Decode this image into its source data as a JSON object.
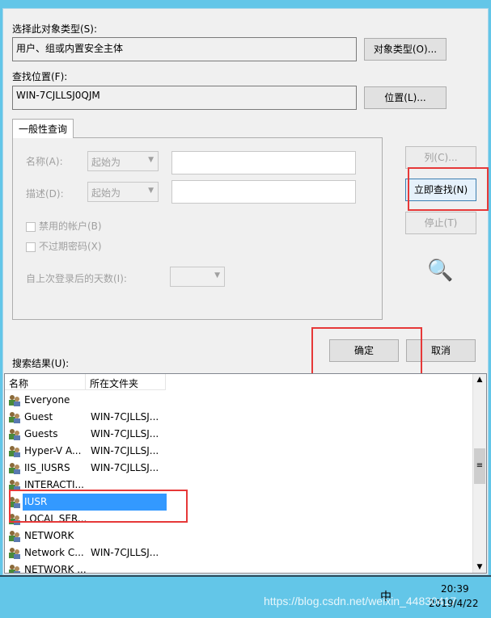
{
  "object_type": {
    "label": "选择此对象类型(S):",
    "value": "用户、组或内置安全主体",
    "button": "对象类型(O)..."
  },
  "location": {
    "label": "查找位置(F):",
    "value": "WIN-7CJLLSJ0QJM",
    "button": "位置(L)..."
  },
  "query_tab": {
    "label": "一般性查询",
    "name_label": "名称(A):",
    "name_mode": "起始为",
    "desc_label": "描述(D):",
    "desc_mode": "起始为",
    "disabled_accounts": "禁用的帐户(B)",
    "no_expire_pwd": "不过期密码(X)",
    "days_label": "自上次登录后的天数(I):"
  },
  "side_buttons": {
    "columns": "列(C)...",
    "find_now": "立即查找(N)",
    "stop": "停止(T)"
  },
  "ok": "确定",
  "cancel": "取消",
  "results": {
    "label": "搜索结果(U):",
    "columns": [
      "名称",
      "所在文件夹"
    ],
    "rows": [
      {
        "name": "Everyone",
        "folder": ""
      },
      {
        "name": "Guest",
        "folder": "WIN-7CJLLSJ..."
      },
      {
        "name": "Guests",
        "folder": "WIN-7CJLLSJ..."
      },
      {
        "name": "Hyper-V A...",
        "folder": "WIN-7CJLLSJ..."
      },
      {
        "name": "IIS_IUSRS",
        "folder": "WIN-7CJLLSJ..."
      },
      {
        "name": "INTERACTI...",
        "folder": ""
      },
      {
        "name": "IUSR",
        "folder": "",
        "selected": true
      },
      {
        "name": "LOCAL SER...",
        "folder": ""
      },
      {
        "name": "NETWORK",
        "folder": ""
      },
      {
        "name": "Network C...",
        "folder": "WIN-7CJLLSJ..."
      },
      {
        "name": "NETWORK ...",
        "folder": ""
      }
    ]
  },
  "taskbar": {
    "time": "20:39",
    "date": "2019/4/22",
    "ime": "中"
  },
  "watermark": "https://blog.csdn.net/weixin_44830417",
  "colors": {
    "selection": "#3399ff",
    "highlight_box": "#e63838",
    "taskbar": "#63c6e8"
  }
}
